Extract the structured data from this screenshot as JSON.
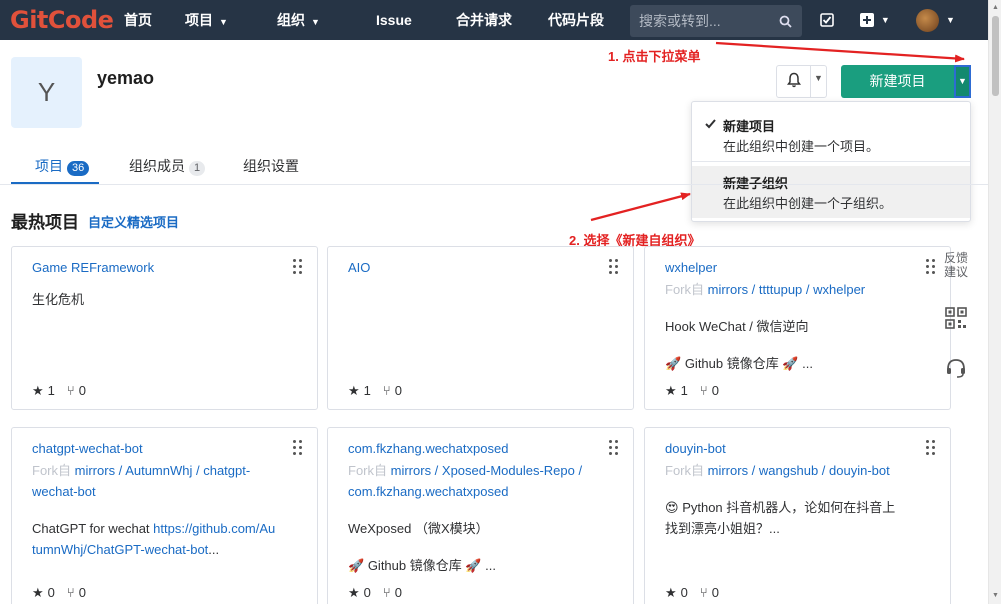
{
  "nav": {
    "logo": "GitCode",
    "items": [
      "首页",
      "项目",
      "组织",
      "Issue",
      "合并请求",
      "代码片段"
    ],
    "search_placeholder": "搜索或转到..."
  },
  "group": {
    "avatar_letter": "Y",
    "name": "yemao"
  },
  "actions": {
    "new_project_label": "新建项目"
  },
  "dropdown": {
    "items": [
      {
        "title": "新建项目",
        "desc": "在此组织中创建一个项目。"
      },
      {
        "title": "新建子组织",
        "desc": "在此组织中创建一个子组织。"
      }
    ]
  },
  "annotations": {
    "step1": "1. 点击下拉菜单",
    "step2": "2. 选择《新建自组织》"
  },
  "tabs": [
    {
      "label": "项目",
      "count": "36"
    },
    {
      "label": "组织成员",
      "count": "1"
    },
    {
      "label": "组织设置",
      "count": ""
    }
  ],
  "section": {
    "title": "最热项目",
    "link": "自定义精选项目"
  },
  "fork_prefix": "Fork自",
  "side": {
    "feedback_line1": "反馈",
    "feedback_line2": "建议"
  },
  "cards": [
    {
      "title": "Game REFramework",
      "desc": "生化危机",
      "stars": "1",
      "forks": "0"
    },
    {
      "title": "AIO",
      "stars": "1",
      "forks": "0"
    },
    {
      "title": "wxhelper",
      "fork_path": "mirrors / ttttupup / wxhelper",
      "desc": "Hook WeChat / 微信逆向",
      "extra": "Github 镜像仓库",
      "ellipsis": "...",
      "stars": "1",
      "forks": "0"
    },
    {
      "title": "chatgpt-wechat-bot",
      "fork_path_1": "mirrors / AutumnWhj / chatgpt-",
      "fork_path_2": "wechat-bot",
      "desc_text": "ChatGPT for wechat ",
      "desc_url_1": "https://github.com/Au",
      "desc_url_2": "tumnWhj/ChatGPT-wechat-bot",
      "desc_tail": "...",
      "stars": "0",
      "forks": "0"
    },
    {
      "title": "com.fkzhang.wechatxposed",
      "fork_path_1": "mirrors / Xposed-Modules-Repo /",
      "fork_path_2": "com.fkzhang.wechatxposed",
      "desc": "WeXposed （微X模块）",
      "extra": "Github 镜像仓库",
      "ellipsis": "...",
      "stars": "0",
      "forks": "0"
    },
    {
      "title": "douyin-bot",
      "fork_path": "mirrors / wangshub / douyin-bot",
      "desc_1": "Python 抖音机器人，论如何在抖音上",
      "desc_2": "找到漂亮小姐姐？...",
      "stars": "0",
      "forks": "0"
    }
  ]
}
